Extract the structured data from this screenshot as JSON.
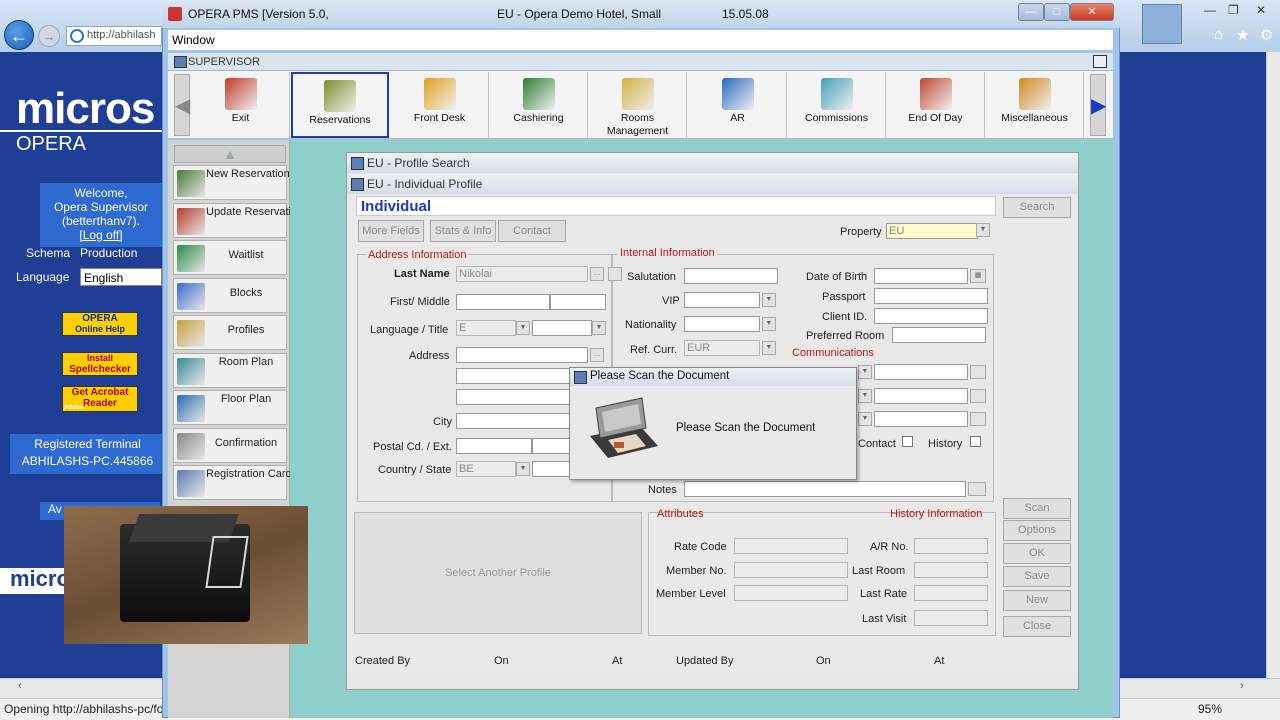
{
  "browser": {
    "url": "http://abhilash",
    "status_text": "Opening http://abhilashs-pc/fo",
    "zoom": "95%"
  },
  "micros_panel": {
    "brand": "micros",
    "product": "OPERA",
    "welcome_line1": "Welcome,",
    "welcome_line2": "Opera Supervisor",
    "welcome_line3": "(betterthanv7).",
    "logoff": "[Log off]",
    "schema_label": "Schema",
    "schema_value": "Production",
    "language_label": "Language",
    "language_value": "English",
    "help_btn_line1": "OPERA",
    "help_btn_line2": "Online Help",
    "spell_btn_line1": "Install",
    "spell_btn_line2": "Spellchecker",
    "acrobat_btn_line1": "Get Acrobat",
    "acrobat_btn_line2": "Reader",
    "acrobat_btn_brand": "Adobe",
    "registered_terminal": "Registered Terminal",
    "terminal_id": "ABHILASHS-PC.445866",
    "avail_btn": "Av",
    "footer_brand": "micro"
  },
  "window": {
    "title": "OPERA PMS [Version 5.0,",
    "hotel": "EU - Opera Demo Hotel, Small",
    "date": "15.05.08",
    "menu_window": "Window",
    "supervisor": "SUPERVISOR"
  },
  "toolbar": [
    {
      "label": "Exit",
      "icon": "exit-door-icon",
      "color": "#c0392b"
    },
    {
      "label": "Reservations",
      "icon": "reservations-icon",
      "color": "#7a8f2a"
    },
    {
      "label": "Front Desk",
      "icon": "front-desk-icon",
      "color": "#e0a020"
    },
    {
      "label": "Cashiering",
      "icon": "cashiering-icon",
      "color": "#2e7d32"
    },
    {
      "label": "Rooms Management",
      "icon": "rooms-management-icon",
      "color": "#d4b040"
    },
    {
      "label": "AR",
      "icon": "ar-icon",
      "color": "#2a6ac0"
    },
    {
      "label": "Commissions",
      "icon": "commissions-icon",
      "color": "#3fa0b8"
    },
    {
      "label": "End Of Day",
      "icon": "end-of-day-icon",
      "color": "#c04830"
    },
    {
      "label": "Miscellaneous",
      "icon": "miscellaneous-icon",
      "color": "#d08a20"
    }
  ],
  "nav": [
    {
      "label": "New Reservation",
      "icon": "new-reservation-icon",
      "color": "#4a7a3a"
    },
    {
      "label": "Update Reservation",
      "icon": "update-reservation-icon",
      "color": "#b83a2a"
    },
    {
      "label": "Waitlist",
      "icon": "waitlist-icon",
      "color": "#2a8a4a"
    },
    {
      "label": "Blocks",
      "icon": "blocks-icon",
      "color": "#3a6ad0"
    },
    {
      "label": "Profiles",
      "icon": "profiles-icon",
      "color": "#c8a040"
    },
    {
      "label": "Room Plan",
      "icon": "room-plan-icon",
      "color": "#3a8a9a"
    },
    {
      "label": "Floor Plan",
      "icon": "floor-plan-icon",
      "color": "#2a6ab0"
    },
    {
      "label": "Confirmation",
      "icon": "confirmation-icon",
      "color": "#888888"
    },
    {
      "label": "Registration Cards",
      "icon": "registration-cards-icon",
      "color": "#5a7ab0"
    }
  ],
  "profile_search": {
    "title": "EU - Profile Search",
    "search_btn": "Search"
  },
  "individual": {
    "window_title": "EU - Individual Profile",
    "heading": "Individual",
    "more_fields": "More Fields",
    "stats_info": "Stats & Info",
    "contact": "Contact",
    "property_label": "Property",
    "property_value": "EU",
    "address_section": "Address Information",
    "internal_section": "Internal Information",
    "communications_section": "Communications",
    "last_name_label": "Last Name",
    "last_name_value": "Nikolai",
    "first_middle_label": "First/ Middle",
    "lang_title_label": "Language / Title",
    "language_value": "E",
    "address_label": "Address",
    "city_label": "City",
    "postal_label": "Postal Cd. / Ext.",
    "country_label": "Country / State",
    "country_value": "BE",
    "salutation_label": "Salutation",
    "vip_label": "VIP",
    "nationality_label": "Nationality",
    "ref_curr_label": "Ref. Curr.",
    "ref_curr_value": "EUR",
    "dob_label": "Date of Birth",
    "passport_label": "Passport",
    "client_id_label": "Client ID.",
    "pref_room_label": "Preferred Room",
    "contact_chk_label": "Contact",
    "history_chk_label": "History",
    "notes_label": "Notes",
    "select_another": "Select Another Profile",
    "attributes_section": "Attributes",
    "history_section": "History Information",
    "rate_code_label": "Rate Code",
    "member_no_label": "Member No.",
    "member_level_label": "Member Level",
    "ar_no_label": "A/R No.",
    "last_room_label": "Last Room",
    "last_rate_label": "Last Rate",
    "last_visit_label": "Last Visit",
    "created_by_label": "Created By",
    "on_label": "On",
    "at_label": "At",
    "updated_by_label": "Updated By",
    "on2_label": "On",
    "at2_label": "At"
  },
  "right_buttons": {
    "scan": "Scan",
    "options": "Options",
    "ok": "OK",
    "save": "Save",
    "new": "New",
    "close": "Close"
  },
  "scan_dialog": {
    "title": "Please Scan the Document",
    "message": "Please Scan the Document"
  }
}
